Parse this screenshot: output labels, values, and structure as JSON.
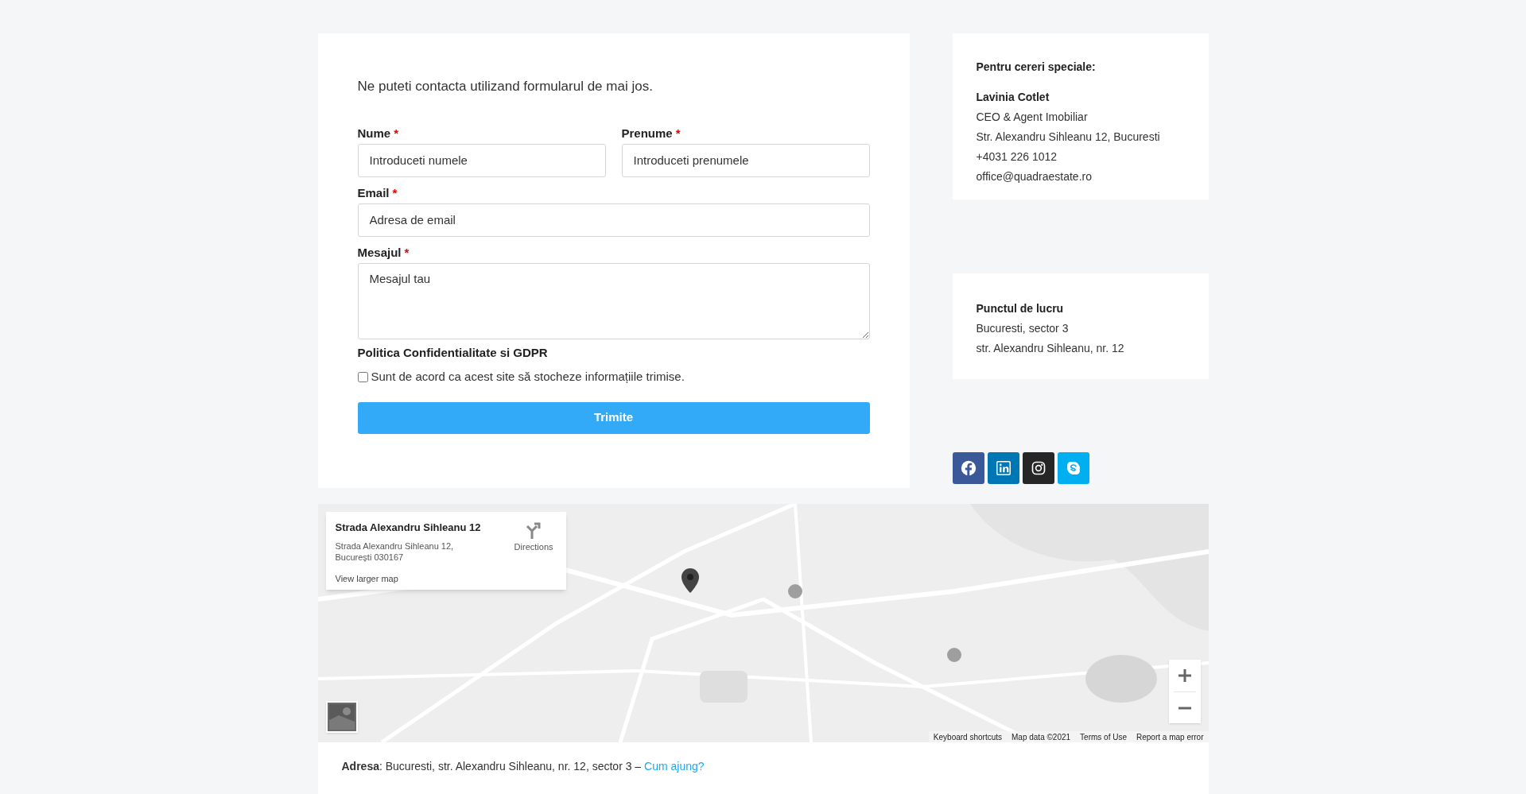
{
  "intro": "Ne puteti contacta utilizand formularul de mai jos.",
  "form": {
    "fields": [
      {
        "label": "Nume",
        "required": true,
        "required_mark": "*",
        "kind": "half",
        "placeholder": "Introduceti numele"
      },
      {
        "label": "Prenume",
        "required": true,
        "required_mark": "*",
        "kind": "half",
        "placeholder": "Introduceti prenumele"
      },
      {
        "label": "Email",
        "required": true,
        "required_mark": "*",
        "kind": "full",
        "placeholder": "Adresa de email"
      },
      {
        "label": "Mesajul",
        "required": true,
        "required_mark": "*",
        "kind": "textarea",
        "placeholder": "Mesajul tau"
      }
    ],
    "consent": {
      "heading": "Politica Confidentialitate si GDPR",
      "label": "Sunt de acord ca acest site să stocheze informațiile trimise.",
      "checked": false
    },
    "submit": "Trimite"
  },
  "cards": [
    {
      "heading": "Pentru cereri speciale:",
      "name": "Lavinia Cotlet",
      "lines": [
        "CEO & Agent Imobiliar",
        "Str. Alexandru Sihleanu 12, Bucuresti",
        "+4031 226 1012",
        "office@quadraestate.ro"
      ]
    },
    {
      "name": "Punctul de lucru",
      "lines": [
        "Bucuresti, sector 3",
        "str. Alexandru Sihleanu, nr. 12"
      ]
    }
  ],
  "social": [
    {
      "kind": "facebook",
      "color": "#3b5998"
    },
    {
      "kind": "linkedin",
      "color": "#0077b5"
    },
    {
      "kind": "instagram",
      "color": "#262626"
    },
    {
      "kind": "skype",
      "color": "#00aff0"
    }
  ],
  "map": {
    "info_card": {
      "title": "Strada Alexandru Sihleanu 12",
      "address": [
        "Strada Alexandru Sihleanu 12,",
        "București 030167"
      ],
      "directions": "Directions",
      "view_larger": "View larger map"
    },
    "attribution": [
      "Keyboard shortcuts",
      "Map data ©2021",
      "Terms of Use",
      "Report a map error"
    ]
  },
  "address": {
    "text": "**Adresa**: Bucuresti, str. Alexandru Sihleanu, nr. 12, sector 3 – ",
    "link": "Cum ajung?"
  }
}
